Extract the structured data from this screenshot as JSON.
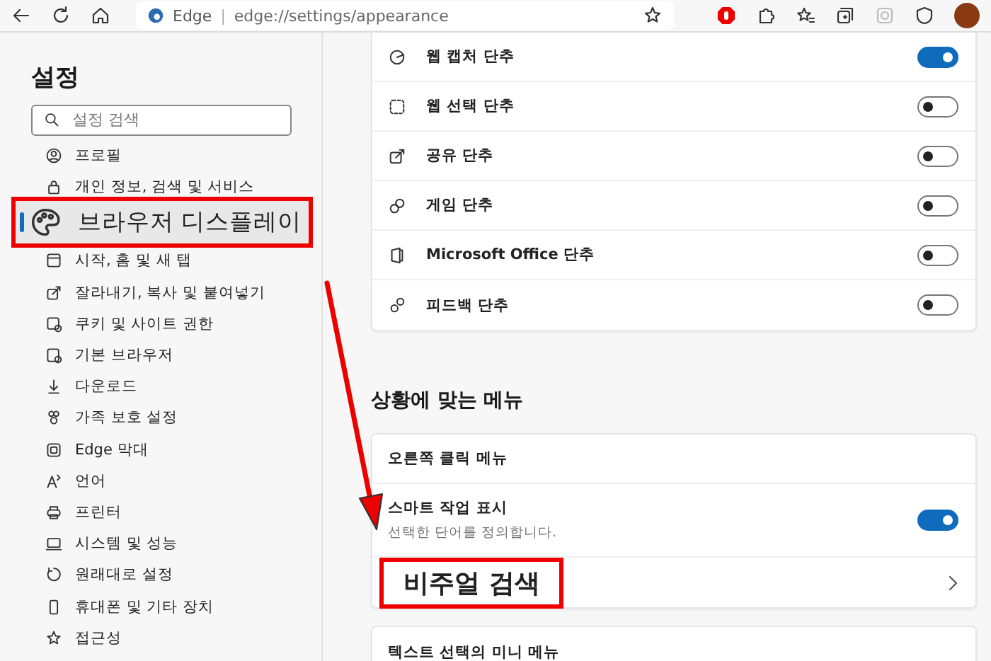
{
  "toolbar": {
    "site_label": "Edge",
    "separator": "|",
    "url": "edge://settings/appearance"
  },
  "sidebar": {
    "title": "설정",
    "search": {
      "placeholder": "설정 검색"
    },
    "items": [
      {
        "label": "프로필",
        "selected": false,
        "highlighted": false
      },
      {
        "label": "개인 정보, 검색 및 서비스",
        "selected": false,
        "highlighted": false
      },
      {
        "label": "브라우저 디스플레이",
        "selected": true,
        "highlighted": true
      },
      {
        "label": "시작, 홈 및 새 탭",
        "selected": false,
        "highlighted": false
      },
      {
        "label": "잘라내기, 복사 및 붙여넣기",
        "selected": false,
        "highlighted": false
      },
      {
        "label": "쿠키 및 사이트 권한",
        "selected": false,
        "highlighted": false
      },
      {
        "label": "기본 브라우저",
        "selected": false,
        "highlighted": false
      },
      {
        "label": "다운로드",
        "selected": false,
        "highlighted": false
      },
      {
        "label": "가족 보호 설정",
        "selected": false,
        "highlighted": false
      },
      {
        "label": "Edge 막대",
        "selected": false,
        "highlighted": false
      },
      {
        "label": "언어",
        "selected": false,
        "highlighted": false
      },
      {
        "label": "프린터",
        "selected": false,
        "highlighted": false
      },
      {
        "label": "시스템 및 성능",
        "selected": false,
        "highlighted": false
      },
      {
        "label": "원래대로 설정",
        "selected": false,
        "highlighted": false
      },
      {
        "label": "휴대폰 및 기타 장치",
        "selected": false,
        "highlighted": false
      },
      {
        "label": "접근성",
        "selected": false,
        "highlighted": false
      }
    ]
  },
  "toolbar_buttons": {
    "rows": [
      {
        "label": "웹 캡처 단추",
        "on": true
      },
      {
        "label": "웹 선택 단추",
        "on": false
      },
      {
        "label": "공유 단추",
        "on": false
      },
      {
        "label": "게임 단추",
        "on": false
      },
      {
        "label": "Microsoft Office 단추",
        "on": false
      },
      {
        "label": "피드백 단추",
        "on": false
      }
    ]
  },
  "context_menus": {
    "heading": "상황에 맞는 메뉴",
    "rows": [
      {
        "kind": "plain",
        "label": "오른쪽 클릭 메뉴",
        "highlighted": false
      },
      {
        "kind": "toggle",
        "label": "스마트 작업 표시",
        "description": "선택한 단어를 정의합니다.",
        "on": true,
        "highlighted": false
      },
      {
        "kind": "link",
        "label": "비주얼 검색",
        "highlighted": true
      }
    ]
  },
  "mini_menu": {
    "label": "텍스트 선택의 미니 메뉴"
  },
  "annotation": {
    "arrow": true
  }
}
